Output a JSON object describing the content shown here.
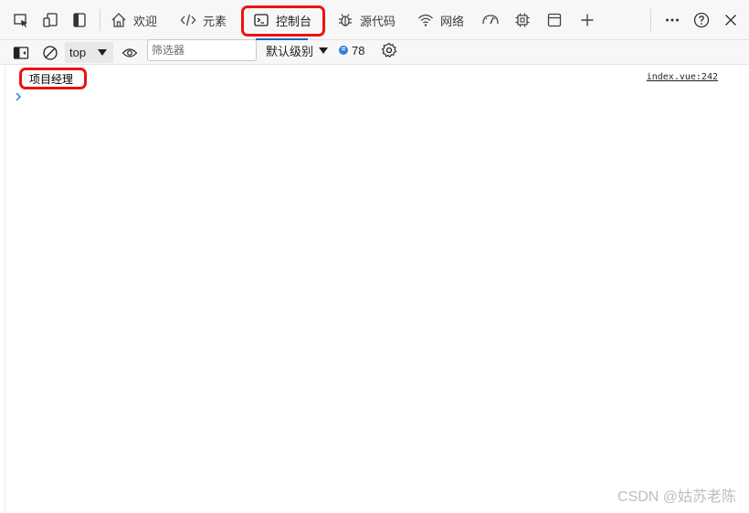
{
  "tabs": [
    {
      "label": "欢迎",
      "icon": "home-icon"
    },
    {
      "label": "元素",
      "icon": "code-brackets-icon"
    },
    {
      "label": "控制台",
      "icon": "console-icon",
      "active": true
    },
    {
      "label": "源代码",
      "icon": "bug-icon"
    },
    {
      "label": "网络",
      "icon": "wifi-icon"
    },
    {
      "label": "",
      "icon": "performance-gauge-icon"
    },
    {
      "label": "",
      "icon": "cpu-chip-icon"
    },
    {
      "label": "",
      "icon": "application-window-icon"
    }
  ],
  "toolbar": {
    "context": "top",
    "filter_placeholder": "筛选器",
    "log_levels": "默认级别",
    "message_count": "78"
  },
  "console": {
    "message": "项目经理",
    "source": "index.vue:242"
  },
  "watermark": "CSDN @姑苏老陈",
  "colors": {
    "highlight": "#ee1111",
    "active_tab_underline": "#0f6cbd",
    "prompt": "#2f7fe0"
  }
}
